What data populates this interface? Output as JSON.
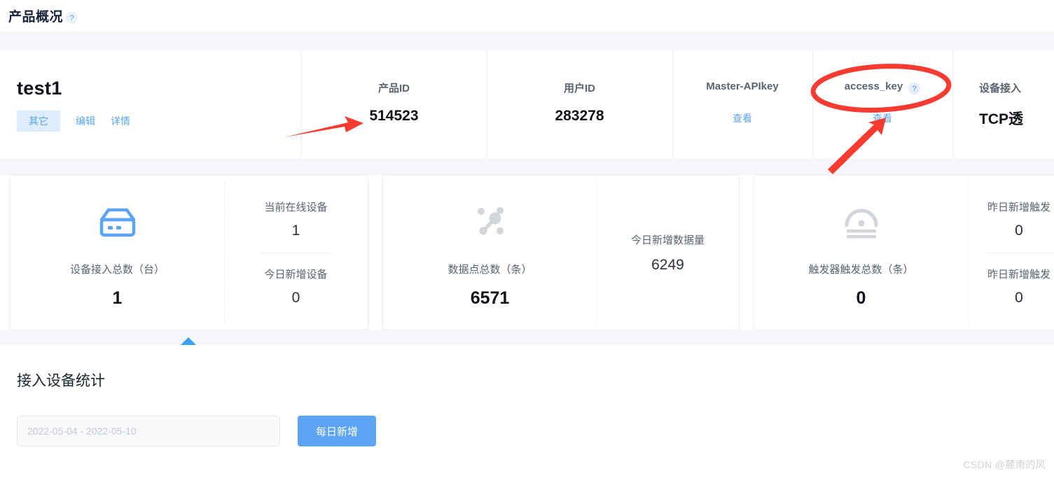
{
  "page": {
    "title": "产品概况",
    "help_icon": "?",
    "watermark": "CSDN @麓南的风"
  },
  "colors": {
    "accent_blue": "#5ba4f3",
    "annotation_red": "#f93a30",
    "page_background": "#f4f6f9",
    "text_dark": "#10131a",
    "text_muted": "#5b6372",
    "tag_background": "#ddedfd",
    "triangle_blue": "#3aa0f5"
  },
  "info_card": {
    "product_name": "test1",
    "tag": "其它",
    "links": [
      {
        "label": "编辑"
      },
      {
        "label": "详情"
      }
    ],
    "fields": [
      {
        "key": "product_id",
        "label": "产品ID",
        "value": "514523",
        "has_help": false,
        "type": "value"
      },
      {
        "key": "user_id",
        "label": "用户ID",
        "value": "283278",
        "has_help": false,
        "type": "value"
      },
      {
        "key": "master_api",
        "label": "Master-APIkey",
        "link": "查看",
        "has_help": false,
        "type": "link"
      },
      {
        "key": "access_key",
        "label": "access_key",
        "link": "查看",
        "has_help": true,
        "help_icon": "?",
        "type": "link"
      },
      {
        "key": "access_mode",
        "label": "设备接入",
        "value": "TCP透",
        "has_help": false,
        "type": "value",
        "truncated": true
      }
    ]
  },
  "stat_cards": [
    {
      "id": "devices",
      "icon": "device-icon",
      "icon_color": "#5ba4f3",
      "title": "设备接入总数（台）",
      "value": "1",
      "side": [
        {
          "label": "当前在线设备",
          "value": "1"
        },
        {
          "label": "今日新增设备",
          "value": "0"
        }
      ]
    },
    {
      "id": "datapoints",
      "icon": "datapoint-network-icon",
      "icon_color": "#d2d5da",
      "title": "数据点总数（条）",
      "value": "6571",
      "side": [
        {
          "label": "今日新增数据量",
          "value": "6249"
        }
      ]
    },
    {
      "id": "triggers",
      "icon": "trigger-icon",
      "icon_color": "#d2d5da",
      "title": "触发器触发总数（条）",
      "value": "0",
      "side": [
        {
          "label": "昨日新增触发",
          "value": "0"
        },
        {
          "label": "昨日新增触发",
          "value": "0"
        }
      ]
    }
  ],
  "bottom_section": {
    "title": "接入设备统计",
    "date_range_value": "2022-05-04 - 2022-05-10",
    "date_range_placeholder": "2022-05-04 - 2022-05-10",
    "button_label": "每日新增"
  },
  "annotations": {
    "ellipse_target": "access_key",
    "arrow_1_target": "514523",
    "arrow_2_target": "access_key-查看"
  }
}
